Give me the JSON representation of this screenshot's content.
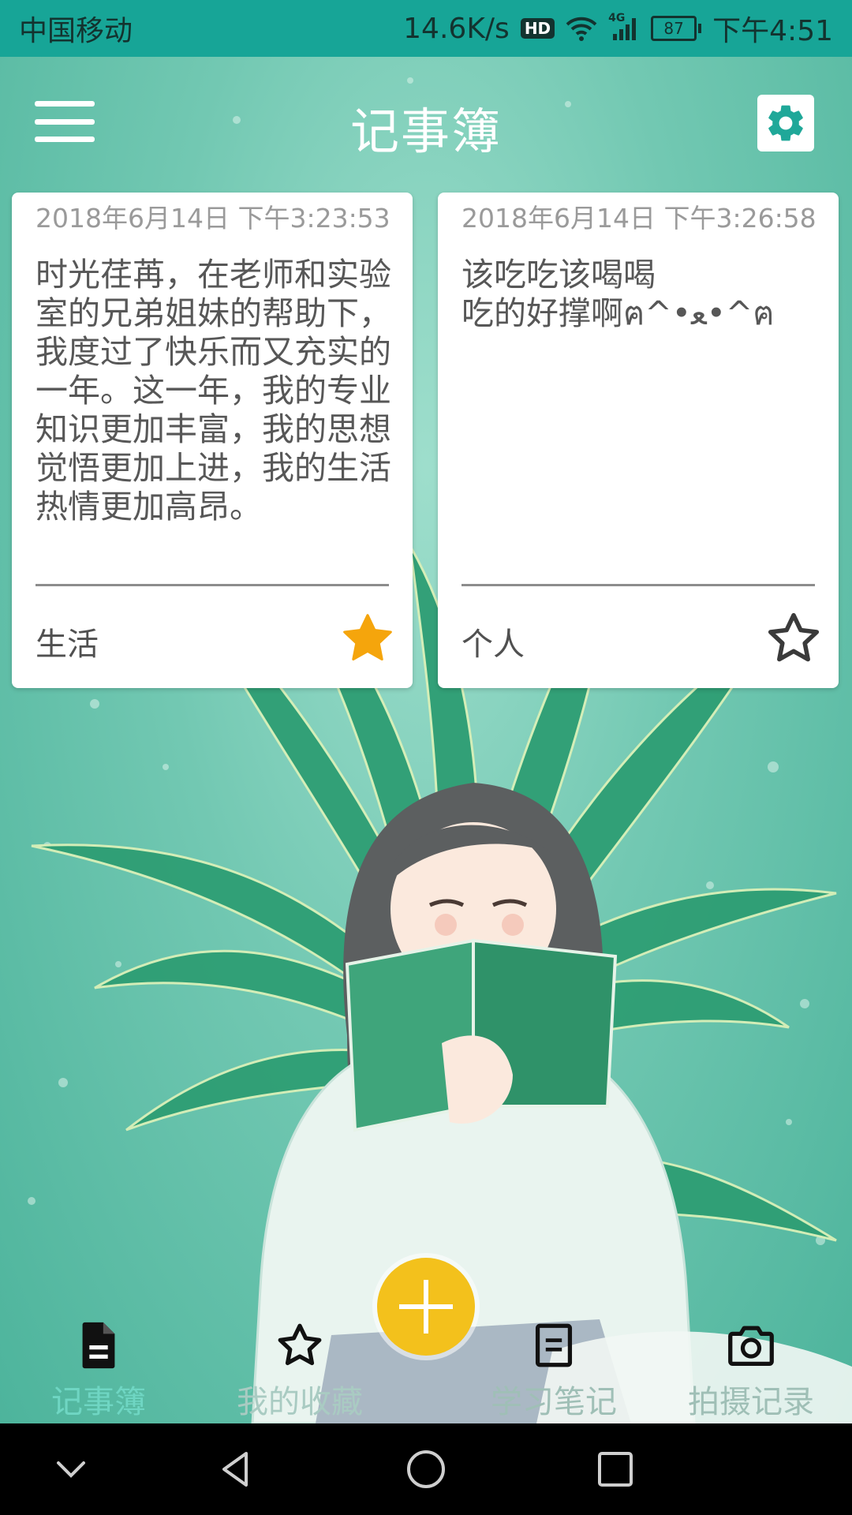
{
  "status_bar": {
    "carrier": "中国移动",
    "speed": "14.6K/s",
    "hd": "HD",
    "network": "4G",
    "battery": "87",
    "time": "下午4:51"
  },
  "header": {
    "title": "记事簿",
    "menu_icon": "hamburger-menu-icon",
    "settings_icon": "gear-icon"
  },
  "notes": [
    {
      "date": "2018年6月14日 下午3:23:53",
      "content": "时光荏苒，在老师和实验室的兄弟姐妹的帮助下，我度过了快乐而又充实的一年。这一年，我的专业知识更加丰富，我的思想觉悟更加上进，我的生活热情更加高昂。",
      "category": "生活",
      "starred": true
    },
    {
      "date": "2018年6月14日 下午3:26:58",
      "content": "该吃吃该喝喝\n吃的好撑啊ฅ^•ﻌ•^ฅ",
      "category": "个人",
      "starred": false
    }
  ],
  "fab": {
    "icon": "plus-icon"
  },
  "tabs": [
    {
      "label": "记事簿",
      "icon": "document-icon",
      "active": true
    },
    {
      "label": "我的收藏",
      "icon": "star-icon",
      "active": false
    },
    {
      "label": "学习笔记",
      "icon": "note-icon",
      "active": false
    },
    {
      "label": "拍摄记录",
      "icon": "camera-icon",
      "active": false
    }
  ],
  "colors": {
    "status_bar": "#17a597",
    "star_filled": "#f5a50c",
    "fab": "#f3c11c",
    "active_tab": "#6fd6c3"
  }
}
